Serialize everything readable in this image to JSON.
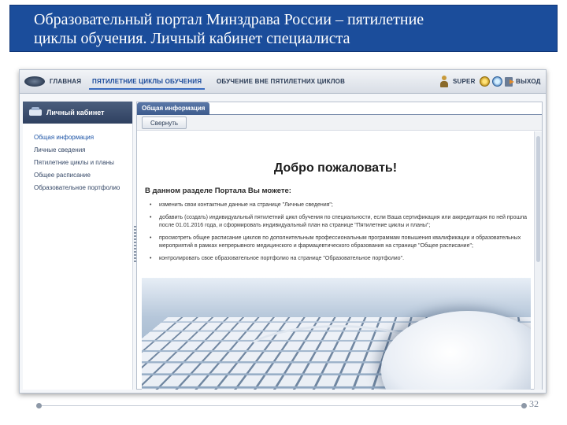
{
  "slide": {
    "title_line1": "Образовательный портал Минздрава России – пятилетние",
    "title_line2": "циклы обучения. Личный кабинет специалиста",
    "page_number": "32"
  },
  "topnav": {
    "home": "ГЛАВНАЯ",
    "five_year": "ПЯТИЛЕТНИЕ ЦИКЛЫ ОБУЧЕНИЯ",
    "outside": "ОБУЧЕНИЕ ВНЕ ПЯТИЛЕТНИХ ЦИКЛОВ",
    "user": "SUPER",
    "exit": "ВЫХОД"
  },
  "sidebar": {
    "header": "Личный кабинет",
    "items": [
      {
        "label": "Общая информация"
      },
      {
        "label": "Личные сведения"
      },
      {
        "label": "Пятилетние циклы и планы"
      },
      {
        "label": "Общее расписание"
      },
      {
        "label": "Образовательное портфолио"
      }
    ]
  },
  "main": {
    "tab": "Общая информация",
    "collapse_button": "Свернуть",
    "welcome": "Добро пожаловать!",
    "intro": "В данном разделе Портала Вы можете:",
    "bullets": [
      "изменить свои контактные данные на странице \"Личные сведения\";",
      "добавить (создать) индивидуальный пятилетний цикл обучения по специальности, если Ваша сертификация или аккредитация по ней прошла после 01.01.2016 года, и сформировать индивидуальный план на странице \"Пятилетние циклы и планы\";",
      "просмотреть общее расписание циклов по дополнительным профессиональным программам повышения квалификации и образовательных мероприятий в рамках непрерывного медицинского и фармацевтического образования на странице \"Общее расписание\";",
      "контролировать свое образовательное портфолио на странице \"Образовательное портфолио\"."
    ]
  },
  "colors": {
    "title_band": "#1b4d9b",
    "sidebar_header": "#2f4060",
    "tab": "#3d5b8d"
  }
}
